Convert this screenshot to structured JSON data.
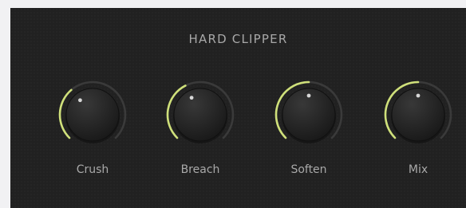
{
  "plugin": {
    "title": "HARD CLIPPER",
    "accent_color": "#cfe07a",
    "track_color": "#3a3a3a",
    "knobs": [
      {
        "label": "Crush",
        "value_fraction": 0.35
      },
      {
        "label": "Breach",
        "value_fraction": 0.4
      },
      {
        "label": "Soften",
        "value_fraction": 0.5
      },
      {
        "label": "Mix",
        "value_fraction": 0.5
      }
    ]
  }
}
